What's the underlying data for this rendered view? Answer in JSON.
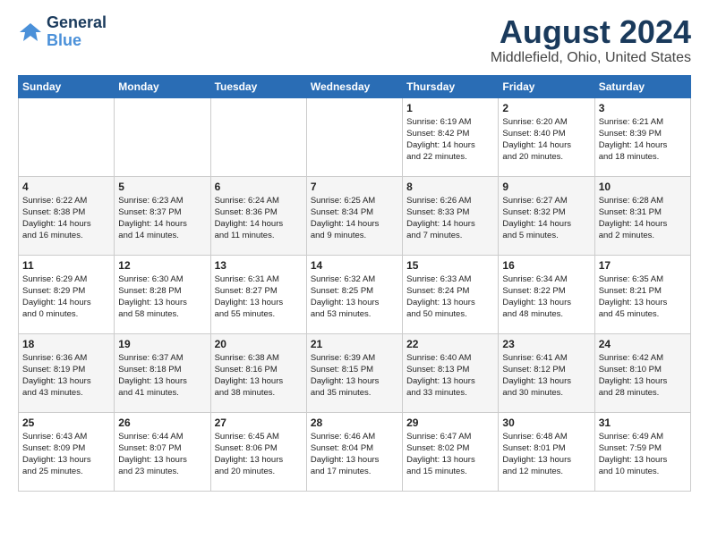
{
  "header": {
    "logo_line1": "General",
    "logo_line2": "Blue",
    "month_year": "August 2024",
    "location": "Middlefield, Ohio, United States"
  },
  "days_of_week": [
    "Sunday",
    "Monday",
    "Tuesday",
    "Wednesday",
    "Thursday",
    "Friday",
    "Saturday"
  ],
  "weeks": [
    [
      {
        "day": "",
        "info": ""
      },
      {
        "day": "",
        "info": ""
      },
      {
        "day": "",
        "info": ""
      },
      {
        "day": "",
        "info": ""
      },
      {
        "day": "1",
        "info": "Sunrise: 6:19 AM\nSunset: 8:42 PM\nDaylight: 14 hours\nand 22 minutes."
      },
      {
        "day": "2",
        "info": "Sunrise: 6:20 AM\nSunset: 8:40 PM\nDaylight: 14 hours\nand 20 minutes."
      },
      {
        "day": "3",
        "info": "Sunrise: 6:21 AM\nSunset: 8:39 PM\nDaylight: 14 hours\nand 18 minutes."
      }
    ],
    [
      {
        "day": "4",
        "info": "Sunrise: 6:22 AM\nSunset: 8:38 PM\nDaylight: 14 hours\nand 16 minutes."
      },
      {
        "day": "5",
        "info": "Sunrise: 6:23 AM\nSunset: 8:37 PM\nDaylight: 14 hours\nand 14 minutes."
      },
      {
        "day": "6",
        "info": "Sunrise: 6:24 AM\nSunset: 8:36 PM\nDaylight: 14 hours\nand 11 minutes."
      },
      {
        "day": "7",
        "info": "Sunrise: 6:25 AM\nSunset: 8:34 PM\nDaylight: 14 hours\nand 9 minutes."
      },
      {
        "day": "8",
        "info": "Sunrise: 6:26 AM\nSunset: 8:33 PM\nDaylight: 14 hours\nand 7 minutes."
      },
      {
        "day": "9",
        "info": "Sunrise: 6:27 AM\nSunset: 8:32 PM\nDaylight: 14 hours\nand 5 minutes."
      },
      {
        "day": "10",
        "info": "Sunrise: 6:28 AM\nSunset: 8:31 PM\nDaylight: 14 hours\nand 2 minutes."
      }
    ],
    [
      {
        "day": "11",
        "info": "Sunrise: 6:29 AM\nSunset: 8:29 PM\nDaylight: 14 hours\nand 0 minutes."
      },
      {
        "day": "12",
        "info": "Sunrise: 6:30 AM\nSunset: 8:28 PM\nDaylight: 13 hours\nand 58 minutes."
      },
      {
        "day": "13",
        "info": "Sunrise: 6:31 AM\nSunset: 8:27 PM\nDaylight: 13 hours\nand 55 minutes."
      },
      {
        "day": "14",
        "info": "Sunrise: 6:32 AM\nSunset: 8:25 PM\nDaylight: 13 hours\nand 53 minutes."
      },
      {
        "day": "15",
        "info": "Sunrise: 6:33 AM\nSunset: 8:24 PM\nDaylight: 13 hours\nand 50 minutes."
      },
      {
        "day": "16",
        "info": "Sunrise: 6:34 AM\nSunset: 8:22 PM\nDaylight: 13 hours\nand 48 minutes."
      },
      {
        "day": "17",
        "info": "Sunrise: 6:35 AM\nSunset: 8:21 PM\nDaylight: 13 hours\nand 45 minutes."
      }
    ],
    [
      {
        "day": "18",
        "info": "Sunrise: 6:36 AM\nSunset: 8:19 PM\nDaylight: 13 hours\nand 43 minutes."
      },
      {
        "day": "19",
        "info": "Sunrise: 6:37 AM\nSunset: 8:18 PM\nDaylight: 13 hours\nand 41 minutes."
      },
      {
        "day": "20",
        "info": "Sunrise: 6:38 AM\nSunset: 8:16 PM\nDaylight: 13 hours\nand 38 minutes."
      },
      {
        "day": "21",
        "info": "Sunrise: 6:39 AM\nSunset: 8:15 PM\nDaylight: 13 hours\nand 35 minutes."
      },
      {
        "day": "22",
        "info": "Sunrise: 6:40 AM\nSunset: 8:13 PM\nDaylight: 13 hours\nand 33 minutes."
      },
      {
        "day": "23",
        "info": "Sunrise: 6:41 AM\nSunset: 8:12 PM\nDaylight: 13 hours\nand 30 minutes."
      },
      {
        "day": "24",
        "info": "Sunrise: 6:42 AM\nSunset: 8:10 PM\nDaylight: 13 hours\nand 28 minutes."
      }
    ],
    [
      {
        "day": "25",
        "info": "Sunrise: 6:43 AM\nSunset: 8:09 PM\nDaylight: 13 hours\nand 25 minutes."
      },
      {
        "day": "26",
        "info": "Sunrise: 6:44 AM\nSunset: 8:07 PM\nDaylight: 13 hours\nand 23 minutes."
      },
      {
        "day": "27",
        "info": "Sunrise: 6:45 AM\nSunset: 8:06 PM\nDaylight: 13 hours\nand 20 minutes."
      },
      {
        "day": "28",
        "info": "Sunrise: 6:46 AM\nSunset: 8:04 PM\nDaylight: 13 hours\nand 17 minutes."
      },
      {
        "day": "29",
        "info": "Sunrise: 6:47 AM\nSunset: 8:02 PM\nDaylight: 13 hours\nand 15 minutes."
      },
      {
        "day": "30",
        "info": "Sunrise: 6:48 AM\nSunset: 8:01 PM\nDaylight: 13 hours\nand 12 minutes."
      },
      {
        "day": "31",
        "info": "Sunrise: 6:49 AM\nSunset: 7:59 PM\nDaylight: 13 hours\nand 10 minutes."
      }
    ]
  ]
}
